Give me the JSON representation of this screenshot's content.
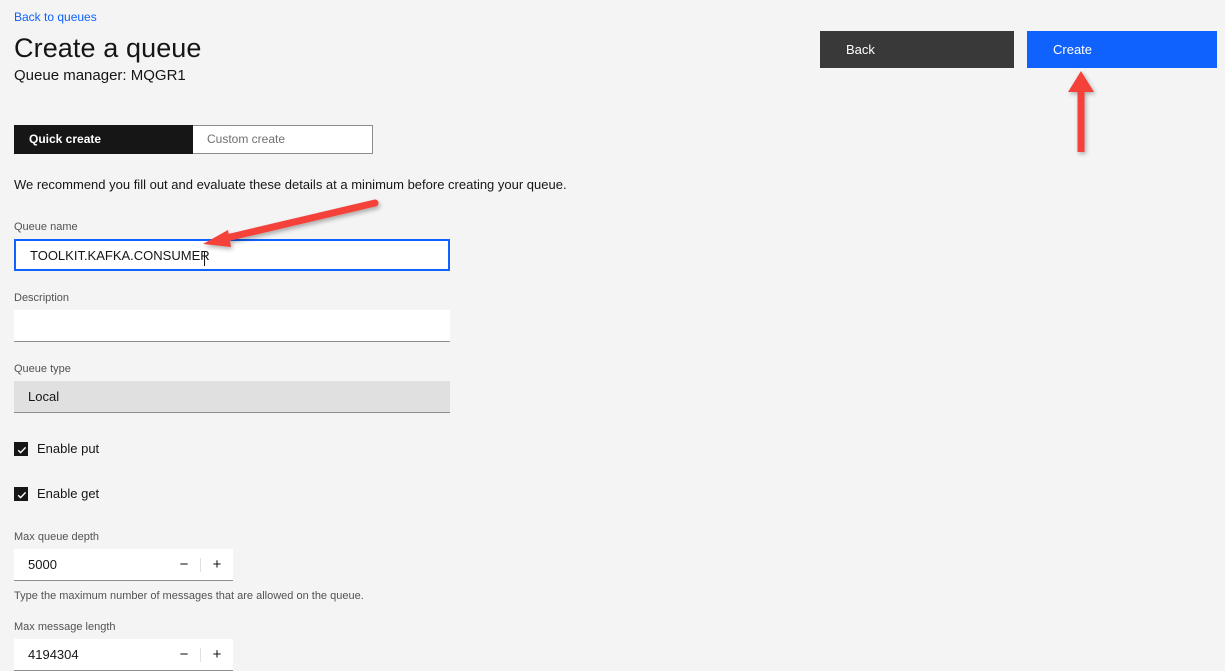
{
  "nav": {
    "back_link": "Back to queues"
  },
  "header": {
    "title": "Create a queue",
    "subtitle": "Queue manager: MQGR1"
  },
  "actions": {
    "back_label": "Back",
    "create_label": "Create",
    "back_color": "#393939",
    "create_color": "#0f62fe"
  },
  "tabs": [
    {
      "label": "Quick create",
      "active": true
    },
    {
      "label": "Custom create",
      "active": false
    }
  ],
  "intro_text": "We recommend you fill out and evaluate these details at a minimum before creating your queue.",
  "form": {
    "queue_name": {
      "label": "Queue name",
      "value": "TOOLKIT.KAFKA.CONSUMER",
      "placeholder": "",
      "focused": true
    },
    "description": {
      "label": "Description",
      "value": "",
      "placeholder": ""
    },
    "queue_type": {
      "label": "Queue type",
      "value": "Local",
      "readonly": true
    },
    "enable_put": {
      "label": "Enable put",
      "checked": true
    },
    "enable_get": {
      "label": "Enable get",
      "checked": true
    },
    "max_queue_depth": {
      "label": "Max queue depth",
      "value": "5000",
      "helper": "Type the maximum number of messages that are allowed on the queue.",
      "decrement": "−",
      "increment": "+"
    },
    "max_message_length": {
      "label": "Max message length",
      "value": "4194304",
      "decrement": "−",
      "increment": "+"
    }
  },
  "annotations": {
    "arrow_color": "#f4433a",
    "queue_name_arrow": "arrow-pointing-to-queue-name-input",
    "create_arrow": "arrow-pointing-to-create-button"
  },
  "colors": {
    "background": "#f4f4f4",
    "link": "#0f62fe",
    "tab_active_bg": "#161616",
    "readonly_bg": "#e0e0e0"
  }
}
